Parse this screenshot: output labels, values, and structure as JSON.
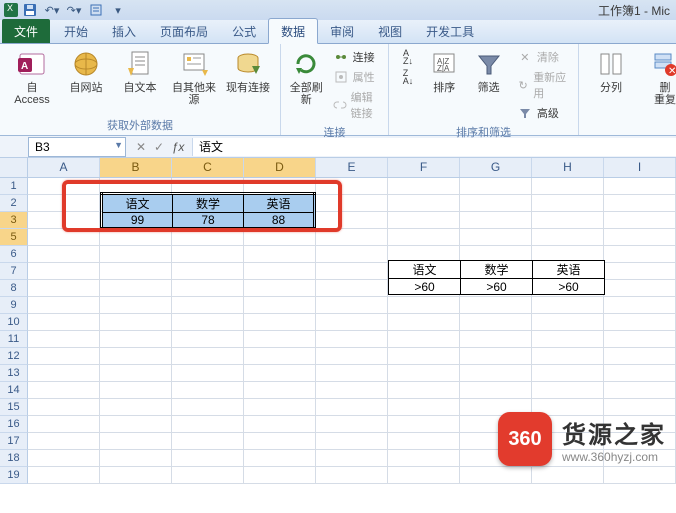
{
  "window": {
    "title": "工作簿1 - Mic"
  },
  "tabs": {
    "file": "文件",
    "items": [
      "开始",
      "插入",
      "页面布局",
      "公式",
      "数据",
      "审阅",
      "视图",
      "开发工具"
    ],
    "active_index": 4
  },
  "ribbon": {
    "group_ext": {
      "label": "获取外部数据",
      "access": "自 Access",
      "web": "自网站",
      "text": "自文本",
      "other": "自其他来源",
      "existing": "现有连接"
    },
    "group_conn": {
      "label": "连接",
      "refresh": "全部刷新",
      "connections": "连接",
      "properties": "属性",
      "editlinks": "编辑链接"
    },
    "group_sort": {
      "label": "排序和筛选",
      "az": "A↓Z",
      "za": "Z↓A",
      "sort": "排序",
      "filter": "筛选",
      "clear": "清除",
      "reapply": "重新应用",
      "advanced": "高级"
    },
    "group_tools": {
      "split": "分列",
      "dedup": "删",
      "repeat": "重复"
    }
  },
  "namebox": {
    "value": "B3"
  },
  "formula": {
    "value": "语文"
  },
  "columns": [
    "A",
    "B",
    "C",
    "D",
    "E",
    "F",
    "G",
    "H",
    "I"
  ],
  "rows": [
    "1",
    "2",
    "3",
    "5",
    "6",
    "7",
    "8",
    "9",
    "10",
    "11",
    "12",
    "13",
    "14",
    "15",
    "16",
    "17",
    "18",
    "19"
  ],
  "selected_cols": [
    "B",
    "C",
    "D"
  ],
  "selected_rows": [
    "3",
    "5"
  ],
  "selection_table": {
    "headers": [
      "语文",
      "数学",
      "英语"
    ],
    "values": [
      "99",
      "78",
      "88"
    ]
  },
  "criteria_table": {
    "headers": [
      "语文",
      "数学",
      "英语"
    ],
    "values": [
      ">60",
      ">60",
      ">60"
    ]
  },
  "watermark": {
    "badge": "360",
    "title": "货源之家",
    "url": "www.360hyzj.com"
  }
}
